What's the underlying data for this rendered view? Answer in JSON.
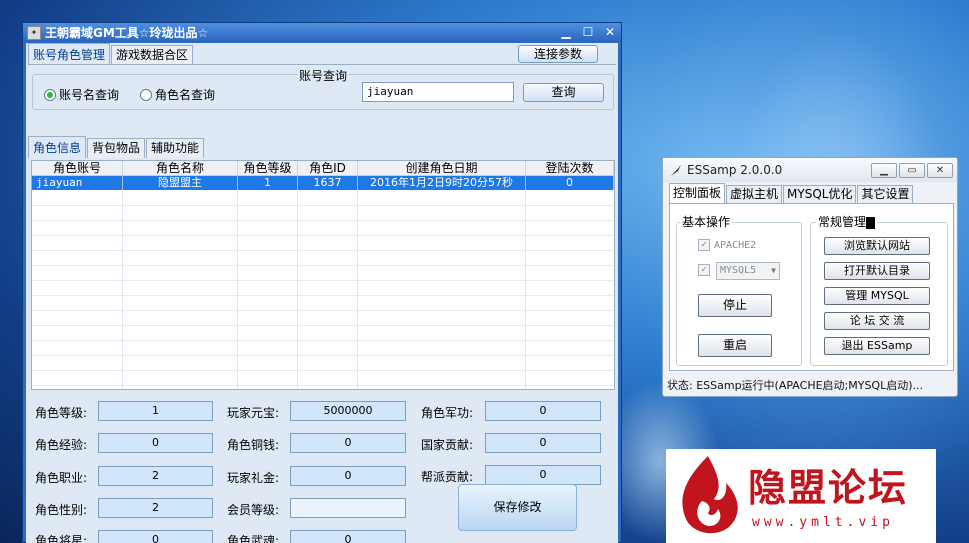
{
  "gm_window": {
    "title": "王朝霸域GM工具☆玲珑出品☆",
    "top_tabs": [
      "账号角色管理",
      "游戏数据合区"
    ],
    "connect_button": "连接参数",
    "query_group_label": "账号查询",
    "radio_account": "账号名查询",
    "radio_role": "角色名查询",
    "query_value": "jiayuan",
    "query_button": "查询",
    "sub_tabs": [
      "角色信息",
      "背包物品",
      "辅助功能"
    ],
    "table": {
      "headers": [
        "角色账号",
        "角色名称",
        "角色等级",
        "角色ID",
        "创建角色日期",
        "登陆次数"
      ],
      "row": [
        "jiayuan",
        "隐盟盟主",
        "1",
        "1637",
        "2016年1月2日9时20分57秒",
        "0"
      ]
    },
    "fields": {
      "level": {
        "label": "角色等级:",
        "value": "1"
      },
      "exp": {
        "label": "角色经验:",
        "value": "0"
      },
      "job": {
        "label": "角色职业:",
        "value": "2"
      },
      "gender": {
        "label": "角色性别:",
        "value": "2"
      },
      "general": {
        "label": "角色将星:",
        "value": "0"
      },
      "yuanbao": {
        "label": "玩家元宝:",
        "value": "5000000"
      },
      "copper": {
        "label": "角色铜钱:",
        "value": "0"
      },
      "gift": {
        "label": "玩家礼金:",
        "value": "0"
      },
      "vip": {
        "label": "会员等级:",
        "value": ""
      },
      "wuhun": {
        "label": "角色武魂:",
        "value": "0"
      },
      "merit": {
        "label": "角色军功:",
        "value": "0"
      },
      "nation": {
        "label": "国家贡献:",
        "value": "0"
      },
      "guild": {
        "label": "帮派贡献:",
        "value": "0"
      }
    },
    "save_button": "保存修改"
  },
  "essamp_window": {
    "title": "ESSamp 2.0.0.0",
    "tabs": [
      "控制面板",
      "虚拟主机",
      "MYSQL优化",
      "其它设置"
    ],
    "basic_group": "基本操作",
    "apache": "APACHE2",
    "mysql": "MYSQL5",
    "stop_button": "停止",
    "restart_button": "重启",
    "common_group": "常规管理",
    "buttons": [
      "浏览默认网站",
      "打开默认目录",
      "管理  MYSQL",
      "论 坛 交 流",
      "退出  ESSamp"
    ],
    "status": "状态: ESSamp运行中(APACHE启动;MYSQL启动)..."
  },
  "watermark": {
    "name": "隐盟论坛",
    "url": "www.ymlt.vip"
  },
  "colors": {
    "selection": "#1e78e6",
    "field_fill": "#cfe6fb",
    "logo_red": "#c2141c"
  }
}
